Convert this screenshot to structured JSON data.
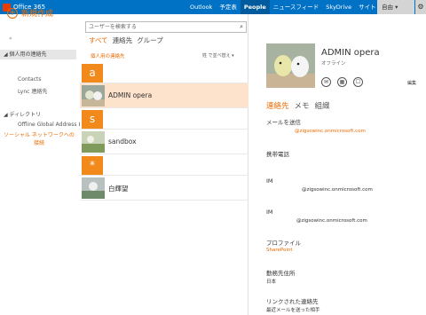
{
  "topbar": {
    "brand": "Office 365",
    "nav": [
      "Outlook",
      "予定表",
      "People",
      "ニュースフィード",
      "SkyDrive",
      "サイト",
      "•••"
    ],
    "active": "People",
    "user": "自由 ▾",
    "gear": "⚙"
  },
  "sidebar": {
    "new_label": "新規作成",
    "collapse": "«",
    "my_contacts": "◢ 個人用の連絡先",
    "items": [
      "Contacts",
      "Lync 連絡先"
    ],
    "directory": "◢ ディレクトリ",
    "dir_items": [
      "Offline Global Address List"
    ],
    "social": "ソーシャル ネットワークへの接続"
  },
  "list": {
    "search_placeholder": "ユーザーを検索する",
    "filters": [
      "すべて",
      "連絡先",
      "グループ"
    ],
    "header": "個人用の連絡先",
    "sort": "姓 で並べ替え ▾",
    "groups": [
      {
        "letter": "a",
        "contacts": [
          "ADMIN opera"
        ]
      },
      {
        "letter": "s",
        "contacts": [
          "sandbox"
        ]
      },
      {
        "letter": "*",
        "contacts": [
          "白輝望"
        ]
      }
    ]
  },
  "detail": {
    "name": "ADMIN opera",
    "status": "オフライン",
    "edit": "編集",
    "tabs": [
      "連絡先",
      "メモ",
      "組織"
    ],
    "send_mail_label": "メールを送信",
    "email": "@zigsowinc.onmicrosoft.com",
    "mobile_label": "携帯電話",
    "im_label": "IM",
    "im1": "@zigsowinc.onmicrosoft.com",
    "im2": "@zigsowinc.onmicrosoft.com",
    "profile_label": "プロファイル",
    "profile_value": "SharePoint",
    "work_label": "勤務先住所",
    "work_value": "日本",
    "linked_label": "リンクされた連絡先",
    "linked_value": "最近メールを送った相手"
  },
  "colors": {
    "accent": "#ea6a00",
    "topbar": "#0072c6",
    "selected": "#fde2cc",
    "tile": "#f18a1b"
  }
}
